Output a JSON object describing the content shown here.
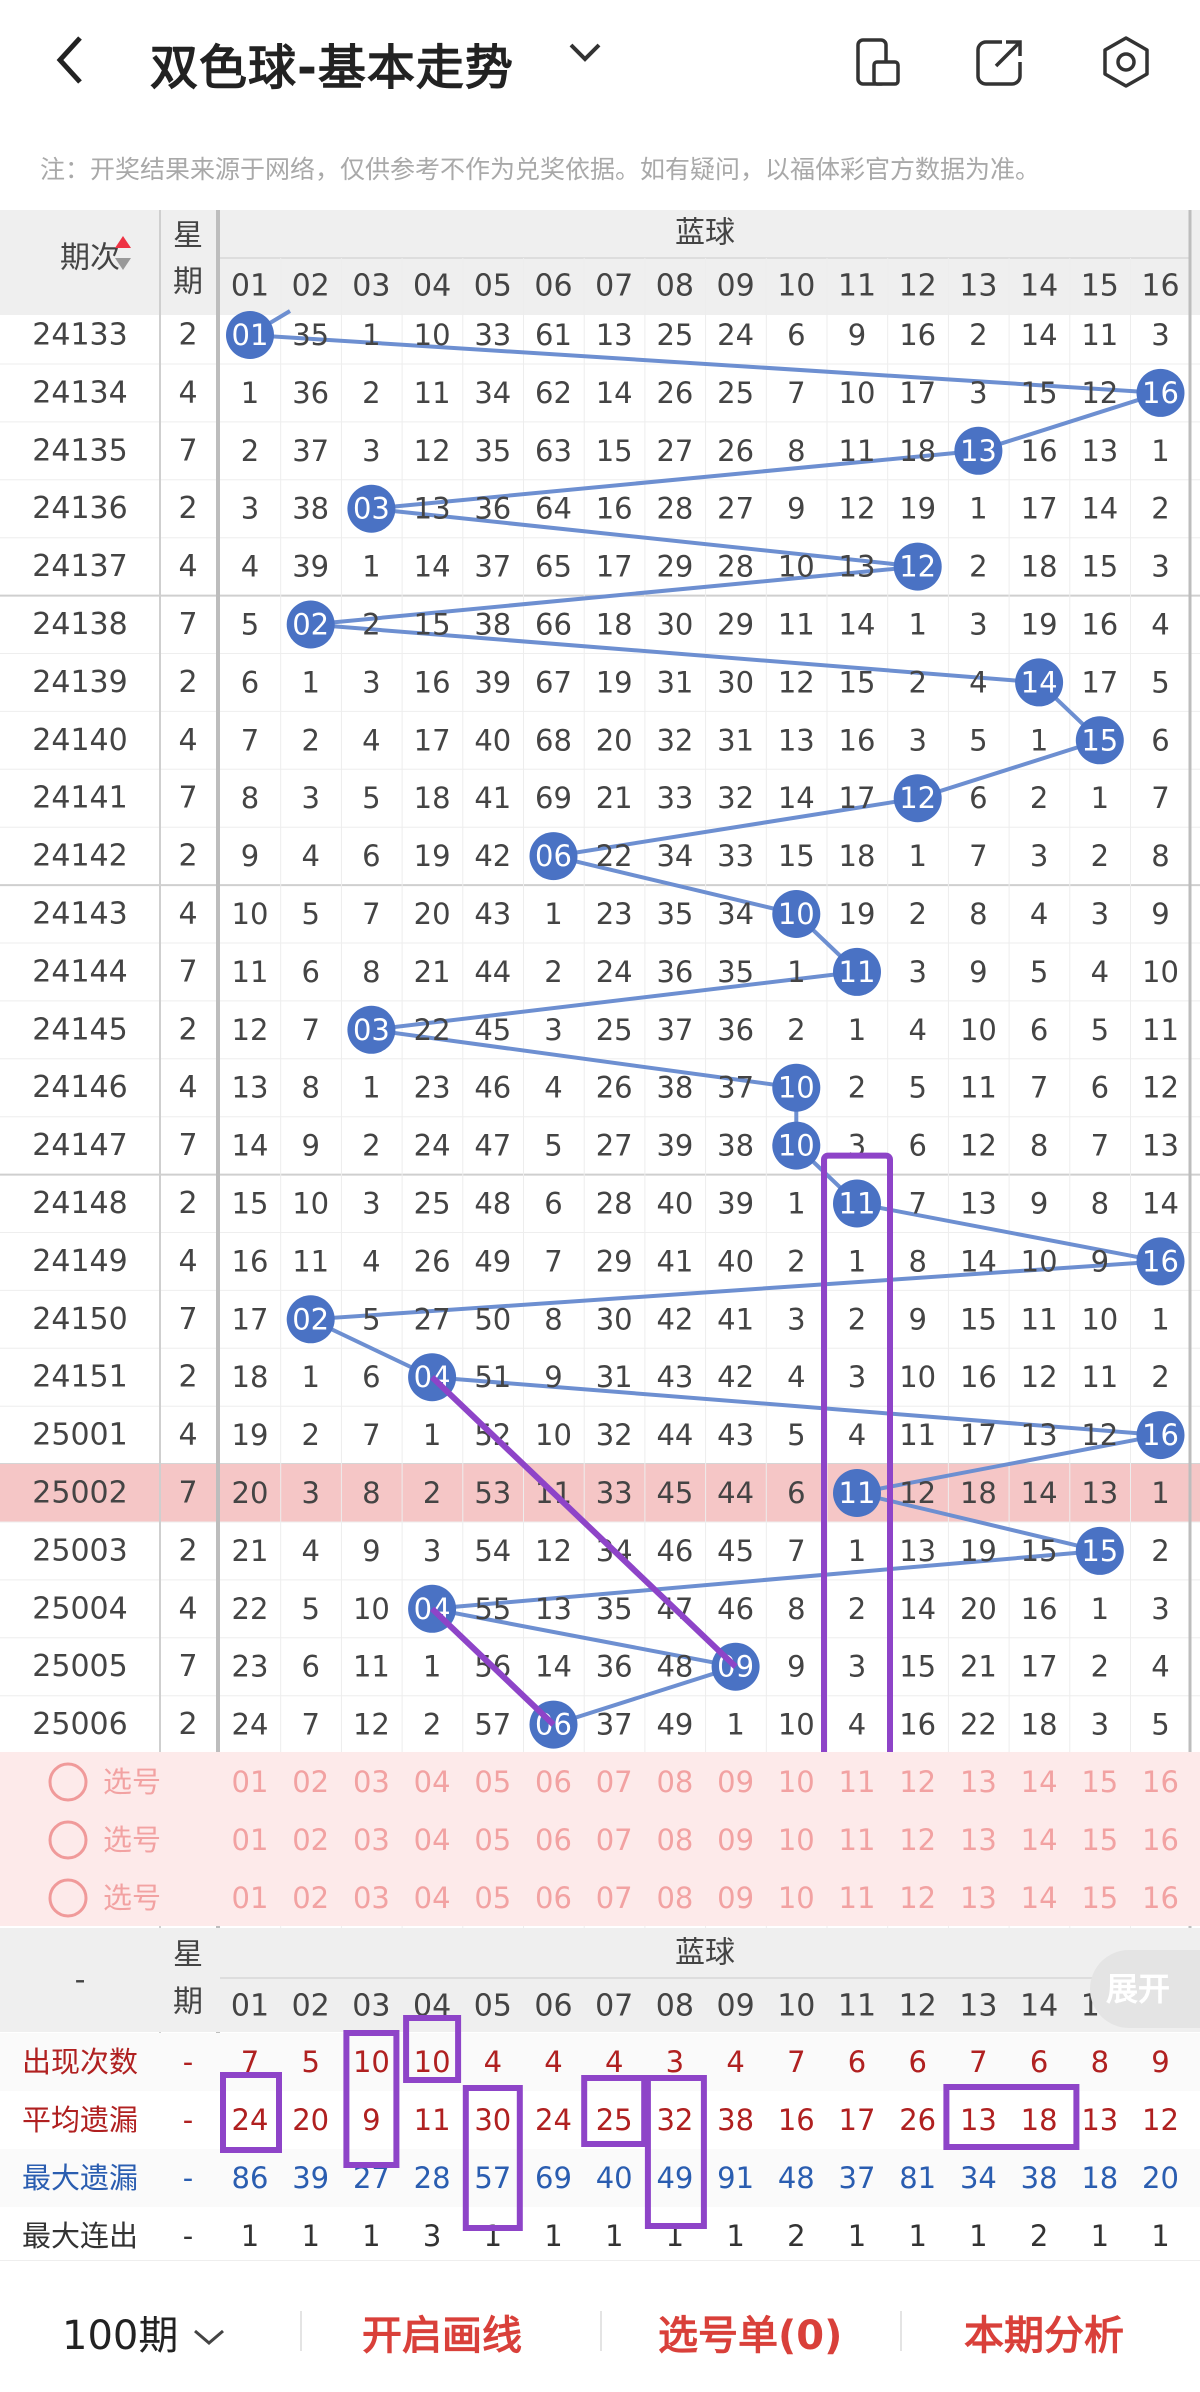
{
  "header": {
    "title": "双色球-基本走势",
    "back_icon": "chevron-left-icon",
    "caret_icon": "chevron-down-icon",
    "icons": [
      "phone-layout-icon",
      "share-icon",
      "settings-icon"
    ]
  },
  "notice": "注：开奖结果来源于网络，仅供参考不作为兑奖依据。如有疑问，以福体彩官方数据为准。",
  "table": {
    "issue_header": "期次",
    "week_header": "星期",
    "blue_header": "蓝球",
    "columns": [
      "01",
      "02",
      "03",
      "04",
      "05",
      "06",
      "07",
      "08",
      "09",
      "10",
      "11",
      "12",
      "13",
      "14",
      "15",
      "16"
    ],
    "rows": [
      {
        "issue": "24133",
        "week": "2",
        "win": 1,
        "cells": [
          "01",
          "35",
          "1",
          "10",
          "33",
          "61",
          "13",
          "25",
          "24",
          "6",
          "9",
          "16",
          "2",
          "14",
          "11",
          "3"
        ]
      },
      {
        "issue": "24134",
        "week": "4",
        "win": 16,
        "cells": [
          "1",
          "36",
          "2",
          "11",
          "34",
          "62",
          "14",
          "26",
          "25",
          "7",
          "10",
          "17",
          "3",
          "15",
          "12",
          "16"
        ]
      },
      {
        "issue": "24135",
        "week": "7",
        "win": 13,
        "cells": [
          "2",
          "37",
          "3",
          "12",
          "35",
          "63",
          "15",
          "27",
          "26",
          "8",
          "11",
          "18",
          "13",
          "16",
          "13",
          "1"
        ]
      },
      {
        "issue": "24136",
        "week": "2",
        "win": 3,
        "cells": [
          "3",
          "38",
          "03",
          "13",
          "36",
          "64",
          "16",
          "28",
          "27",
          "9",
          "12",
          "19",
          "1",
          "17",
          "14",
          "2"
        ]
      },
      {
        "issue": "24137",
        "week": "4",
        "win": 12,
        "cells": [
          "4",
          "39",
          "1",
          "14",
          "37",
          "65",
          "17",
          "29",
          "28",
          "10",
          "13",
          "12",
          "2",
          "18",
          "15",
          "3"
        ]
      },
      {
        "issue": "24138",
        "week": "7",
        "win": 2,
        "cells": [
          "5",
          "02",
          "2",
          "15",
          "38",
          "66",
          "18",
          "30",
          "29",
          "11",
          "14",
          "1",
          "3",
          "19",
          "16",
          "4"
        ]
      },
      {
        "issue": "24139",
        "week": "2",
        "win": 14,
        "cells": [
          "6",
          "1",
          "3",
          "16",
          "39",
          "67",
          "19",
          "31",
          "30",
          "12",
          "15",
          "2",
          "4",
          "14",
          "17",
          "5"
        ]
      },
      {
        "issue": "24140",
        "week": "4",
        "win": 15,
        "cells": [
          "7",
          "2",
          "4",
          "17",
          "40",
          "68",
          "20",
          "32",
          "31",
          "13",
          "16",
          "3",
          "5",
          "1",
          "15",
          "6"
        ]
      },
      {
        "issue": "24141",
        "week": "7",
        "win": 12,
        "cells": [
          "8",
          "3",
          "5",
          "18",
          "41",
          "69",
          "21",
          "33",
          "32",
          "14",
          "17",
          "12",
          "6",
          "2",
          "1",
          "7"
        ]
      },
      {
        "issue": "24142",
        "week": "2",
        "win": 6,
        "cells": [
          "9",
          "4",
          "6",
          "19",
          "42",
          "06",
          "22",
          "34",
          "33",
          "15",
          "18",
          "1",
          "7",
          "3",
          "2",
          "8"
        ]
      },
      {
        "issue": "24143",
        "week": "4",
        "win": 10,
        "cells": [
          "10",
          "5",
          "7",
          "20",
          "43",
          "1",
          "23",
          "35",
          "34",
          "10",
          "19",
          "2",
          "8",
          "4",
          "3",
          "9"
        ]
      },
      {
        "issue": "24144",
        "week": "7",
        "win": 11,
        "cells": [
          "11",
          "6",
          "8",
          "21",
          "44",
          "2",
          "24",
          "36",
          "35",
          "1",
          "11",
          "3",
          "9",
          "5",
          "4",
          "10"
        ]
      },
      {
        "issue": "24145",
        "week": "2",
        "win": 3,
        "cells": [
          "12",
          "7",
          "03",
          "22",
          "45",
          "3",
          "25",
          "37",
          "36",
          "2",
          "1",
          "4",
          "10",
          "6",
          "5",
          "11"
        ]
      },
      {
        "issue": "24146",
        "week": "4",
        "win": 10,
        "cells": [
          "13",
          "8",
          "1",
          "23",
          "46",
          "4",
          "26",
          "38",
          "37",
          "10",
          "2",
          "5",
          "11",
          "7",
          "6",
          "12"
        ]
      },
      {
        "issue": "24147",
        "week": "7",
        "win": 10,
        "cells": [
          "14",
          "9",
          "2",
          "24",
          "47",
          "5",
          "27",
          "39",
          "38",
          "10",
          "3",
          "6",
          "12",
          "8",
          "7",
          "13"
        ]
      },
      {
        "issue": "24148",
        "week": "2",
        "win": 11,
        "cells": [
          "15",
          "10",
          "3",
          "25",
          "48",
          "6",
          "28",
          "40",
          "39",
          "1",
          "11",
          "7",
          "13",
          "9",
          "8",
          "14"
        ]
      },
      {
        "issue": "24149",
        "week": "4",
        "win": 16,
        "cells": [
          "16",
          "11",
          "4",
          "26",
          "49",
          "7",
          "29",
          "41",
          "40",
          "2",
          "1",
          "8",
          "14",
          "10",
          "9",
          "16"
        ]
      },
      {
        "issue": "24150",
        "week": "7",
        "win": 2,
        "cells": [
          "17",
          "02",
          "5",
          "27",
          "50",
          "8",
          "30",
          "42",
          "41",
          "3",
          "2",
          "9",
          "15",
          "11",
          "10",
          "1"
        ]
      },
      {
        "issue": "24151",
        "week": "2",
        "win": 4,
        "cells": [
          "18",
          "1",
          "6",
          "04",
          "51",
          "9",
          "31",
          "43",
          "42",
          "4",
          "3",
          "10",
          "16",
          "12",
          "11",
          "2"
        ]
      },
      {
        "issue": "25001",
        "week": "4",
        "win": 16,
        "cells": [
          "19",
          "2",
          "7",
          "1",
          "52",
          "10",
          "32",
          "44",
          "43",
          "5",
          "4",
          "11",
          "17",
          "13",
          "12",
          "16"
        ]
      },
      {
        "issue": "25002",
        "week": "7",
        "win": 11,
        "cells": [
          "20",
          "3",
          "8",
          "2",
          "53",
          "11",
          "33",
          "45",
          "44",
          "6",
          "11",
          "12",
          "18",
          "14",
          "13",
          "1"
        ]
      },
      {
        "issue": "25003",
        "week": "2",
        "win": 15,
        "cells": [
          "21",
          "4",
          "9",
          "3",
          "54",
          "12",
          "34",
          "46",
          "45",
          "7",
          "1",
          "13",
          "19",
          "15",
          "15",
          "2"
        ]
      },
      {
        "issue": "25004",
        "week": "4",
        "win": 4,
        "cells": [
          "22",
          "5",
          "10",
          "04",
          "55",
          "13",
          "35",
          "47",
          "46",
          "8",
          "2",
          "14",
          "20",
          "16",
          "1",
          "3"
        ]
      },
      {
        "issue": "25005",
        "week": "7",
        "win": 9,
        "cells": [
          "23",
          "6",
          "11",
          "1",
          "56",
          "14",
          "36",
          "48",
          "09",
          "9",
          "3",
          "15",
          "21",
          "17",
          "2",
          "4"
        ]
      },
      {
        "issue": "25006",
        "week": "2",
        "win": 6,
        "cells": [
          "24",
          "7",
          "12",
          "2",
          "57",
          "06",
          "37",
          "49",
          "1",
          "10",
          "4",
          "16",
          "22",
          "18",
          "3",
          "5"
        ]
      }
    ],
    "select_label": "选号",
    "stats_dash": "-",
    "stats": [
      {
        "label": "出现次数",
        "dash": "-",
        "values": [
          "7",
          "5",
          "10",
          "10",
          "4",
          "4",
          "4",
          "3",
          "4",
          "7",
          "6",
          "6",
          "7",
          "6",
          "8",
          "9"
        ]
      },
      {
        "label": "平均遗漏",
        "dash": "-",
        "values": [
          "24",
          "20",
          "9",
          "11",
          "30",
          "24",
          "25",
          "32",
          "38",
          "16",
          "17",
          "26",
          "13",
          "18",
          "13",
          "12"
        ]
      },
      {
        "label": "最大遗漏",
        "dash": "-",
        "values": [
          "86",
          "39",
          "27",
          "28",
          "57",
          "69",
          "40",
          "49",
          "91",
          "48",
          "37",
          "81",
          "34",
          "38",
          "18",
          "20"
        ]
      },
      {
        "label": "最大连出",
        "dash": "-",
        "values": [
          "1",
          "1",
          "1",
          "3",
          "1",
          "1",
          "1",
          "1",
          "1",
          "2",
          "1",
          "1",
          "1",
          "2",
          "1",
          "1"
        ]
      }
    ],
    "colors": {
      "ball": "#4a72c4",
      "line": "#6d8fd1",
      "purple": "#8e44c8",
      "highlight_row": "#f5c6c6",
      "pick_bg": "#fdeaea",
      "pick_text": "#f2a2a2",
      "header_bg": "#efefef",
      "stat_red": "#b02020",
      "stat_blue": "#2a5db0"
    }
  },
  "expand_label": "展开",
  "footer": {
    "period": "100期",
    "draw_line": "开启画线",
    "pick_list": "选号单(0)",
    "analysis": "本期分析"
  }
}
